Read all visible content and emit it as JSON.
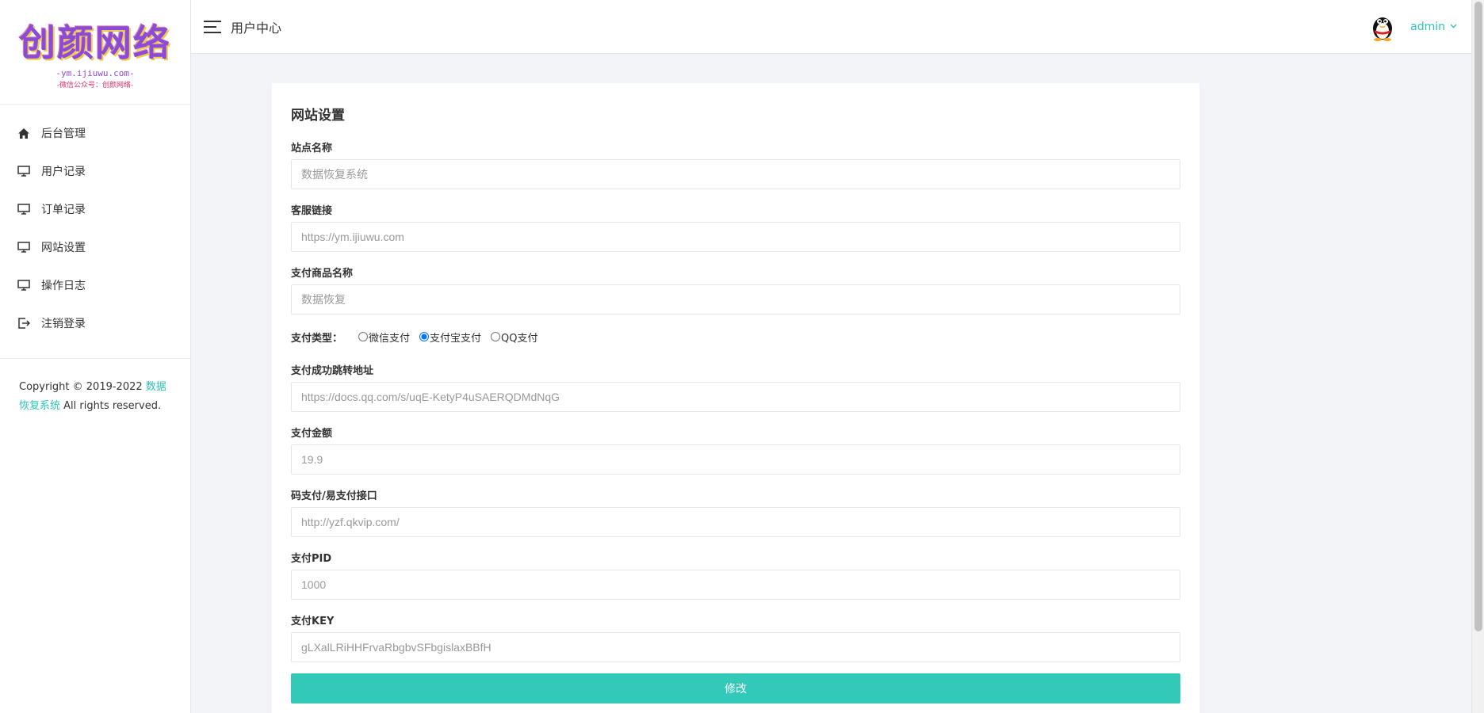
{
  "sidebar": {
    "logo_main": "创颜网络",
    "logo_sub": "-ym.ijiuwu.com-",
    "logo_sub2": "-微信公众号：创颜网络-",
    "items": [
      {
        "label": "后台管理",
        "icon": "home-icon"
      },
      {
        "label": "用户记录",
        "icon": "monitor-icon"
      },
      {
        "label": "订单记录",
        "icon": "monitor-icon"
      },
      {
        "label": "网站设置",
        "icon": "monitor-icon"
      },
      {
        "label": "操作日志",
        "icon": "monitor-icon"
      },
      {
        "label": "注销登录",
        "icon": "logout-icon"
      }
    ],
    "copyright_prefix": "Copyright © 2019-2022 ",
    "copyright_link": "数据恢复系统",
    "copyright_suffix": " All rights reserved."
  },
  "header": {
    "title": "用户中心",
    "user": "admin"
  },
  "form": {
    "title": "网站设置",
    "site_name": {
      "label": "站点名称",
      "placeholder": "数据恢复系统"
    },
    "service_link": {
      "label": "客服链接",
      "placeholder": "https://ym.ijiuwu.com"
    },
    "product_name": {
      "label": "支付商品名称",
      "placeholder": "数据恢复"
    },
    "pay_type": {
      "label": "支付类型：",
      "options": [
        "微信支付",
        "支付宝支付",
        "QQ支付"
      ],
      "selected": "支付宝支付"
    },
    "success_url": {
      "label": "支付成功跳转地址",
      "placeholder": "https://docs.qq.com/s/uqE-KetyP4uSAERQDMdNqG"
    },
    "amount": {
      "label": "支付金额",
      "placeholder": "19.9"
    },
    "api": {
      "label": "码支付/易支付接口",
      "placeholder": "http://yzf.qkvip.com/"
    },
    "pid": {
      "label": "支付PID",
      "placeholder": "1000"
    },
    "key": {
      "label": "支付KEY",
      "placeholder": "gLXalLRiHHFrvaRbgbvSFbgislaxBBfH"
    },
    "submit_label": "修改"
  },
  "colors": {
    "accent": "#33c9b8",
    "link": "#2ec4b6",
    "logo": "#8a4bd8"
  }
}
